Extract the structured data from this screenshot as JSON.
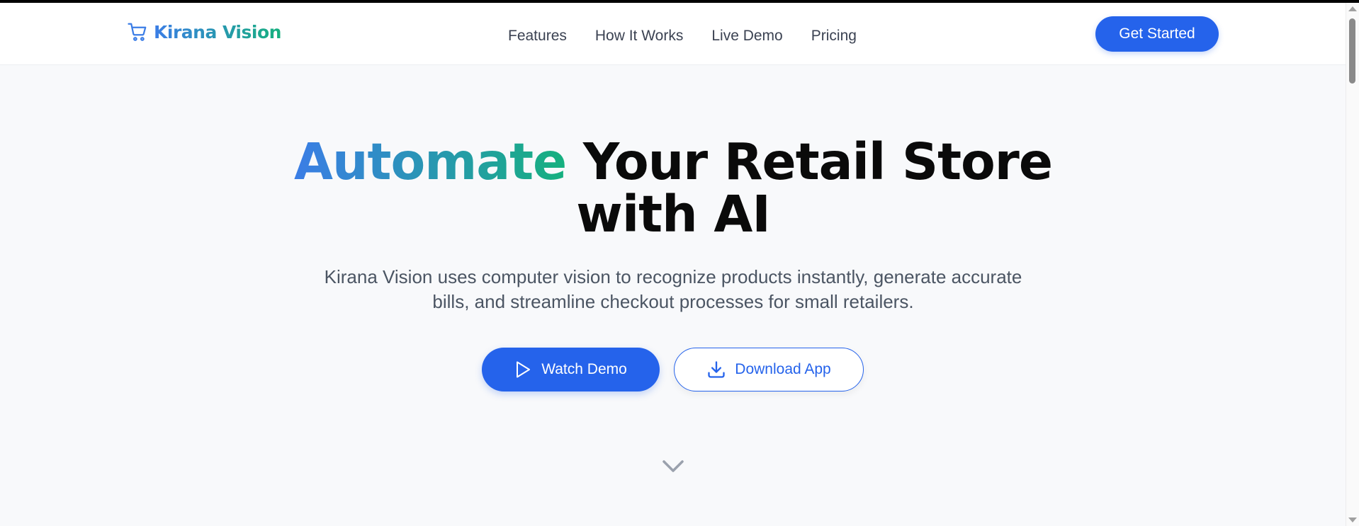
{
  "brand": {
    "name": "Kirana Vision",
    "icon": "shopping-cart-icon",
    "gradient_start": "#3b7de6",
    "gradient_end": "#16b07e"
  },
  "nav": {
    "links": [
      "Features",
      "How It Works",
      "Live Demo",
      "Pricing"
    ],
    "cta_label": "Get Started"
  },
  "hero": {
    "title_highlight": "Automate",
    "title_rest_line1": " Your Retail Store",
    "title_line2": "with AI",
    "subtitle_line1": "Kirana Vision uses computer vision to recognize products instantly, generate accurate",
    "subtitle_line2": "bills, and streamline checkout processes for small retailers.",
    "primary_button": {
      "label": "Watch Demo",
      "icon": "play-icon"
    },
    "secondary_button": {
      "label": "Download App",
      "icon": "download-icon"
    },
    "scroll_indicator_icon": "chevron-down-icon"
  },
  "colors": {
    "primary": "#2563eb",
    "background": "#f8f9fb",
    "text_dark": "#0a0a0a",
    "text_muted": "#4b5563"
  }
}
